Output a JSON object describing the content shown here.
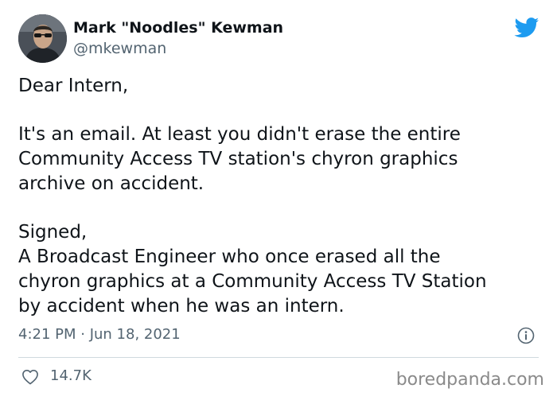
{
  "author": {
    "display_name": "Mark \"Noodles\" Kewman",
    "handle": "@mkewman",
    "avatar_icon": "user-avatar-photo"
  },
  "brand": {
    "icon": "twitter-bird-icon",
    "color": "#1d9bf0"
  },
  "tweet": {
    "lines": [
      "Dear Intern,",
      "",
      "It's an email.  At least you didn't erase the entire",
      "Community Access TV station's chyron graphics",
      "archive on accident.",
      "",
      "Signed,",
      "A Broadcast Engineer who once erased all the",
      "chyron graphics at a Community Access TV Station",
      "by accident when he was an intern."
    ],
    "timestamp": "4:21 PM · Jun 18, 2021",
    "likes": "14.7K"
  },
  "watermark": "boredpanda.com",
  "colors": {
    "text": "#0f1419",
    "secondary": "#536471",
    "divider": "#cfd9de"
  }
}
